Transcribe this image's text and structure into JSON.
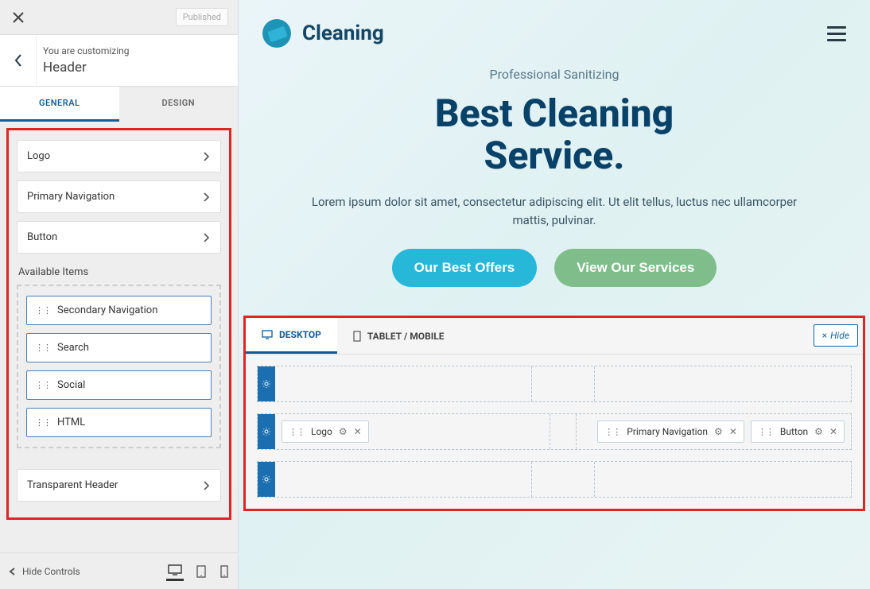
{
  "sidebar": {
    "published": "Published",
    "customizing_label": "You are customizing",
    "section_title": "Header",
    "tabs": {
      "general": "GENERAL",
      "design": "DESIGN"
    },
    "options": [
      {
        "label": "Logo"
      },
      {
        "label": "Primary Navigation"
      },
      {
        "label": "Button"
      }
    ],
    "available_label": "Available Items",
    "available_items": [
      {
        "label": "Secondary Navigation"
      },
      {
        "label": "Search"
      },
      {
        "label": "Social"
      },
      {
        "label": "HTML"
      }
    ],
    "transparent_header": "Transparent Header",
    "hide_controls": "Hide Controls"
  },
  "preview": {
    "brand": "Cleaning",
    "kicker": "Professional Sanitizing",
    "title_line1": "Best Cleaning",
    "title_line2": "Service.",
    "description": "Lorem ipsum dolor sit amet, consectetur adipiscing elit. Ut elit tellus, luctus nec ullamcorper mattis, pulvinar.",
    "btn_primary": "Our Best Offers",
    "btn_secondary": "View Our Services"
  },
  "builder": {
    "tab_desktop": "DESKTOP",
    "tab_mobile": "TABLET / MOBILE",
    "hide": "Hide",
    "chips": {
      "logo": "Logo",
      "primary_nav": "Primary Navigation",
      "button": "Button"
    }
  },
  "colors": {
    "accent": "#125f9b",
    "highlight": "#e02424",
    "btn_blue": "#26b7d9",
    "btn_green": "#7fbe8a"
  }
}
